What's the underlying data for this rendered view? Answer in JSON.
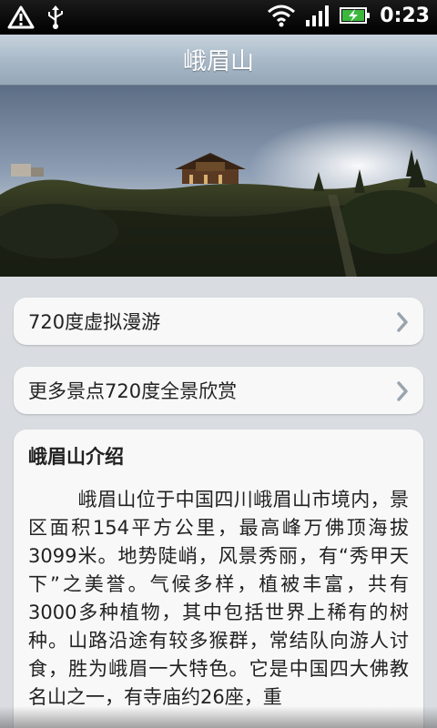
{
  "status_bar": {
    "time": "0:23",
    "icons": [
      "warning-icon",
      "usb-icon",
      "wifi-icon",
      "signal-icon",
      "battery-charging-icon"
    ]
  },
  "header": {
    "title": "峨眉山"
  },
  "panorama": {
    "icon": "panorama-image"
  },
  "menu": {
    "items": [
      {
        "label": "720度虚拟漫游",
        "icon": "chevron-right-icon"
      },
      {
        "label": "更多景点720度全景欣赏",
        "icon": "chevron-right-icon"
      }
    ]
  },
  "intro": {
    "title": "峨眉山介绍",
    "body": "峨眉山位于中国四川峨眉山市境内，景区面积154平方公里，最高峰万佛顶海拔3099米。地势陡峭，风景秀丽，有“秀甲天下”之美誉。气候多样，植被丰富，共有3000多种植物，其中包括世界上稀有的树种。山路沿途有较多猴群，常结队向游人讨食，胜为峨眉一大特色。它是中国四大佛教名山之一，有寺庙约26座，重"
  },
  "colors": {
    "status_bar": "#000000",
    "title_bar": "#a7b7c6",
    "background": "#d9dde2",
    "card": "#f8f8f8",
    "battery_green": "#3db83d"
  }
}
